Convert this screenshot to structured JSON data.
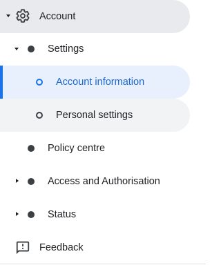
{
  "nav": {
    "account": {
      "label": "Account",
      "icon": "gear-icon",
      "expanded": true
    },
    "settings": {
      "label": "Settings",
      "expanded": true
    },
    "account_information": {
      "label": "Account information",
      "active": true
    },
    "personal_settings": {
      "label": "Personal settings"
    },
    "policy_centre": {
      "label": "Policy centre"
    },
    "access_and_authorisation": {
      "label": "Access and Authorisation",
      "expanded": false
    },
    "status": {
      "label": "Status",
      "expanded": false
    },
    "feedback": {
      "label": "Feedback",
      "icon": "feedback-icon"
    }
  },
  "colors": {
    "accent": "#1a73e8",
    "active_text": "#1967d2",
    "active_bg": "#e8f0fe",
    "selected_bg": "#e8eaed",
    "hover_bg": "#f1f3f4"
  }
}
